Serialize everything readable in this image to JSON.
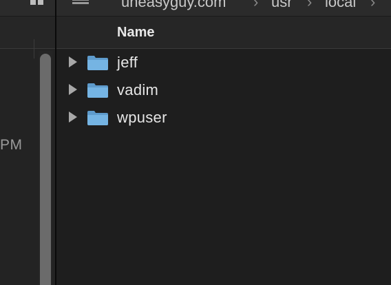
{
  "path_bar": {
    "crumbs": [
      "uneasyguy.com",
      "usr",
      "local"
    ],
    "separator": "›"
  },
  "left_pane": {
    "time_fragment": "PM"
  },
  "columns": {
    "name": "Name"
  },
  "items": [
    {
      "label": "jeff",
      "icon": "folder-icon"
    },
    {
      "label": "vadim",
      "icon": "folder-icon"
    },
    {
      "label": "wpuser",
      "icon": "folder-icon"
    }
  ],
  "colors": {
    "background": "#1e1e1e",
    "folder": "#6aa7d6",
    "text": "#e6e6e6"
  }
}
